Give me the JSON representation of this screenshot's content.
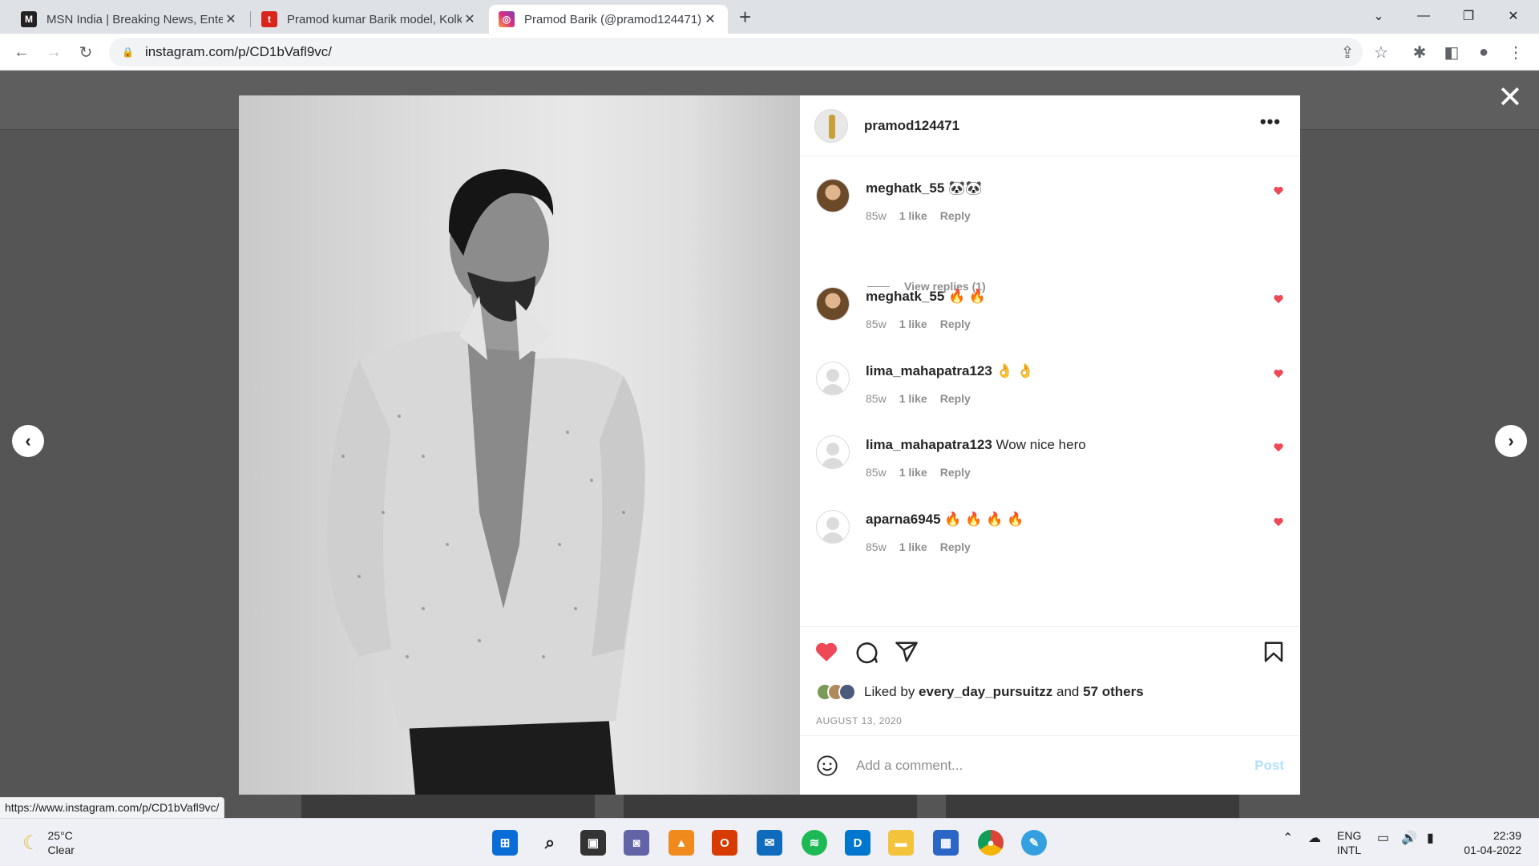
{
  "browser": {
    "tabs": [
      {
        "title": "MSN India | Breaking News, Enter",
        "active": false
      },
      {
        "title": "Pramod kumar Barik model, Kolk",
        "active": false
      },
      {
        "title": "Pramod Barik (@pramod124471)",
        "active": true
      }
    ],
    "url": "instagram.com/p/CD1bVafl9vc/",
    "status_url": "https://www.instagram.com/p/CD1bVafl9vc/"
  },
  "post": {
    "owner": "pramod124471",
    "more": "•••",
    "close": "✕",
    "comments": [
      {
        "user": "meghatk_55",
        "text": " 🐼🐼",
        "age": "85w",
        "likes": "1 like",
        "reply": "Reply",
        "view_replies": "View replies (1)",
        "avatar": "girl"
      },
      {
        "user": "meghatk_55",
        "text": " 🔥 🔥",
        "age": "85w",
        "likes": "1 like",
        "reply": "Reply",
        "avatar": "girl"
      },
      {
        "user": "lima_mahapatra123",
        "text": " 👌 👌",
        "age": "85w",
        "likes": "1 like",
        "reply": "Reply",
        "avatar": "blank"
      },
      {
        "user": "lima_mahapatra123",
        "text": " Wow nice hero",
        "age": "85w",
        "likes": "1 like",
        "reply": "Reply",
        "avatar": "blank"
      },
      {
        "user": "aparna6945",
        "text": " 🔥 🔥 🔥 🔥",
        "age": "85w",
        "likes": "1 like",
        "reply": "Reply",
        "avatar": "blank"
      }
    ],
    "liked_by_prefix": "Liked by ",
    "liked_by_user": "every_day_pursuitzz",
    "liked_by_and": " and ",
    "liked_by_others": "57 others",
    "date": "AUGUST 13, 2020",
    "comment_placeholder": "Add a comment...",
    "post_button": "Post"
  },
  "taskbar": {
    "temperature": "25°C",
    "weather": "Clear",
    "lang_1": "ENG",
    "lang_2": "INTL",
    "time": "22:39",
    "date": "01-04-2022"
  },
  "colors": {
    "like_red": "#ed4956",
    "post_blue": "#b2dffc",
    "ig_text": "#262626",
    "muted": "#8e8e8e"
  }
}
